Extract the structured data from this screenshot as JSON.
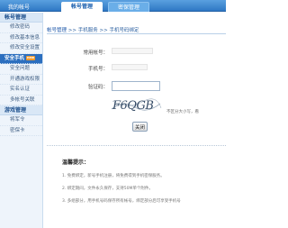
{
  "header": {
    "account_label": "我的帐号",
    "tabs": [
      {
        "label": "帐号管理",
        "active": true
      },
      {
        "label": "密保管理",
        "active": false
      }
    ]
  },
  "sidebar": {
    "section1_title": "帐号管理",
    "section1_items": [
      "修改密码",
      "修改基本信息",
      "修改安全设置"
    ],
    "active_item": "安全手机",
    "active_badge": "new",
    "section2_items": [
      "安全问题",
      "开通游戏权限",
      "实名认证",
      "多帐号关联"
    ],
    "section2_title": "游戏管理",
    "section2_sub_items": [
      "将军令",
      "密保卡"
    ]
  },
  "breadcrumb": {
    "link": "帐号管理",
    "sep1": ">>",
    "crumb2": "手机服务",
    "sep2": ">>",
    "crumb3": "手机号码绑定"
  },
  "form": {
    "account_label": "常用帐号：",
    "phone_label": "手机号：",
    "code_label": "验证码：",
    "code_value": "",
    "captcha_text": "F6QGB",
    "captcha_tip": "不区分大小写，看",
    "submit_label": "关闭"
  },
  "notes": {
    "title": "温馨提示：",
    "lines": [
      "1. 免费绑定，新号手机注册，将免费得到手机密保服务。",
      "2. 绑定期间，文件永久保存，支持50M单个附件。",
      "3. 多组部分，用手机号码保存所有帐号，绑定部分后可享受手机号"
    ]
  },
  "colors": {
    "topbar": "#3f88d2",
    "sidebar_active": "#2c6fbf",
    "link": "#1a55a8"
  }
}
